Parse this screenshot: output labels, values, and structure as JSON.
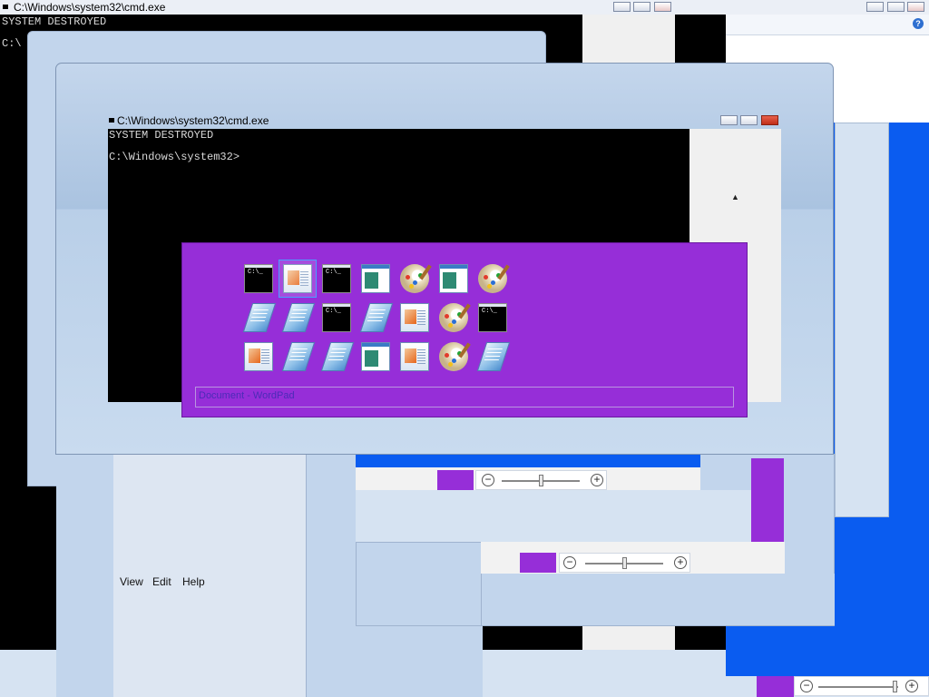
{
  "back_cmd": {
    "title": "C:\\Windows\\system32\\cmd.exe",
    "line1": "SYSTEM DESTROYED",
    "line2": "C:\\"
  },
  "front_cmd": {
    "title": "C:\\Windows\\system32\\cmd.exe",
    "line1": "SYSTEM DESTROYED",
    "line2": "C:\\Windows\\system32>"
  },
  "task_switcher": {
    "caption": "Document - WordPad",
    "rows": [
      [
        "cmd-icon",
        "wordpad-icon",
        "cmd-icon",
        "document-icon",
        "paint-icon",
        "document-icon",
        "paint-icon"
      ],
      [
        "notepad-icon",
        "notepad-icon",
        "cmd-icon",
        "notepad-icon",
        "wordpad-icon",
        "paint-icon",
        "cmd-icon"
      ],
      [
        "wordpad-icon",
        "notepad-icon",
        "notepad-icon",
        "document-icon",
        "wordpad-icon",
        "paint-icon",
        "notepad-icon"
      ]
    ],
    "selected": "row 1, item 2",
    "cmd_glyph": "C:\\_"
  },
  "paint_menu": {
    "items": [
      "View",
      "Edit",
      "Help"
    ]
  },
  "zoom_controls": {
    "minus": "−",
    "plus": "+"
  },
  "help_icon_glyph": "?",
  "scroll_up_glyph": "▲",
  "colors": {
    "accent_purple": "#962ed8",
    "xp_blue": "#0a5cf0",
    "window_frame": "#b9cfe8",
    "cmd_black": "#000000"
  }
}
